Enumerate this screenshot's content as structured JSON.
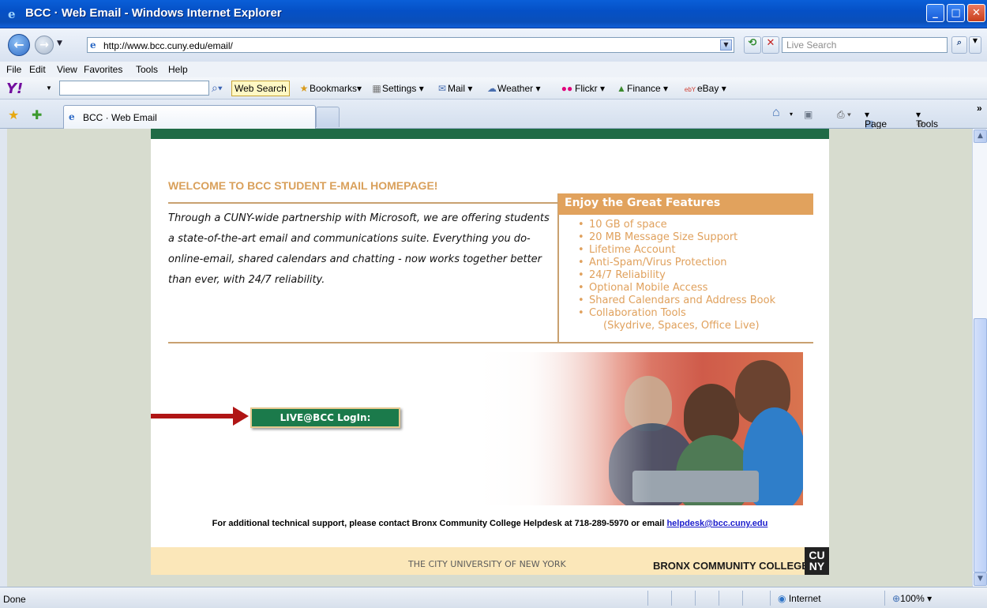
{
  "window": {
    "title": "BCC · Web Email - Windows Internet Explorer",
    "minimize": "_",
    "maximize": "□",
    "close": "✕"
  },
  "address": {
    "url": "http://www.bcc.cuny.edu/email/",
    "search_placeholder": "Live Search"
  },
  "menu": [
    "File",
    "Edit",
    "View",
    "Favorites",
    "Tools",
    "Help"
  ],
  "yahoo_toolbar": {
    "web_search": "Web Search",
    "bookmarks": "Bookmarks",
    "settings": "Settings",
    "mail": "Mail",
    "weather": "Weather",
    "flickr": "Flickr",
    "finance": "Finance",
    "ebay": "eBay"
  },
  "tab": {
    "label": "BCC · Web Email"
  },
  "command_bar": {
    "page": "Page",
    "tools": "Tools"
  },
  "content": {
    "welcome": "WELCOME TO BCC STUDENT E-MAIL HOMEPAGE!",
    "intro_lines": [
      "Through a CUNY-wide partnership with Microsoft, we are offering students",
      "a state-of-the-art email and communications suite. Everything you do-",
      "online-email, shared calendars and chatting - now works together better",
      "than ever, with 24/7 reliability."
    ],
    "features_heading": "Enjoy the Great Features",
    "features": [
      "10 GB of space",
      "20 MB Message Size Support",
      "Lifetime Account",
      "Anti-Spam/Virus Protection",
      "24/7 Reliability",
      "Optional Mobile Access",
      "Shared Calendars and Address Book",
      "Collaboration Tools"
    ],
    "features_sub": "(Skydrive, Spaces, Office Live)",
    "login_button": "LIVE@BCC LogIn:",
    "support_text": "For additional technical support, please contact Bronx Community College Helpdesk at 718-289-5970 or email ",
    "support_email": "helpdesk@bcc.cuny.edu",
    "footer_cuny": "THE CITY UNIVERSITY OF NEW YORK",
    "footer_bcc": "BRONX COMMUNITY COLLEGE IS",
    "footer_logo_top": "CU",
    "footer_logo_bottom": "NY"
  },
  "status": {
    "left": "Done",
    "zone": "Internet",
    "zoom": "100%"
  },
  "colors": {
    "accent_orange": "#e1a25d",
    "green": "#1b7a4b",
    "arrow_red": "#b01515"
  }
}
